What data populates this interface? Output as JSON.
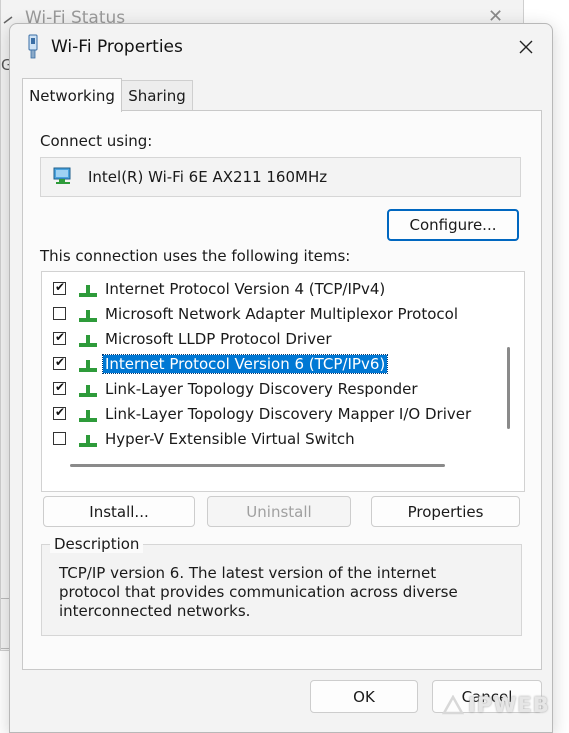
{
  "background_window": {
    "title": "Wi-Fi Status",
    "edge_text": "G"
  },
  "dialog": {
    "title": "Wi-Fi Properties",
    "title_icon": "network-adapter-icon"
  },
  "tabs": [
    {
      "label": "Networking",
      "active": true
    },
    {
      "label": "Sharing",
      "active": false
    }
  ],
  "connect_using": {
    "label": "Connect using:",
    "adapter": "Intel(R) Wi-Fi 6E AX211 160MHz",
    "adapter_icon": "network-card-icon"
  },
  "configure_label": "Configure...",
  "items_label": "This connection uses the following items:",
  "items": [
    {
      "label": "Internet Protocol Version 4 (TCP/IPv4)",
      "checked": true,
      "selected": false
    },
    {
      "label": "Microsoft Network Adapter Multiplexor Protocol",
      "checked": false,
      "selected": false
    },
    {
      "label": "Microsoft LLDP Protocol Driver",
      "checked": true,
      "selected": false
    },
    {
      "label": "Internet Protocol Version 6 (TCP/IPv6)",
      "checked": true,
      "selected": true
    },
    {
      "label": "Link-Layer Topology Discovery Responder",
      "checked": true,
      "selected": false
    },
    {
      "label": "Link-Layer Topology Discovery Mapper I/O Driver",
      "checked": true,
      "selected": false
    },
    {
      "label": "Hyper-V Extensible Virtual Switch",
      "checked": false,
      "selected": false
    }
  ],
  "actions": {
    "install": "Install...",
    "uninstall": "Uninstall",
    "properties": "Properties"
  },
  "description": {
    "legend": "Description",
    "text": "TCP/IP version 6. The latest version of the internet protocol that provides communication across diverse interconnected networks."
  },
  "footer": {
    "ok": "OK",
    "cancel": "Cancel"
  },
  "watermark": "IPWEB",
  "colors": {
    "accent": "#0067c0",
    "selection": "#0078d4",
    "protocol_icon": "#2e9b3a"
  }
}
